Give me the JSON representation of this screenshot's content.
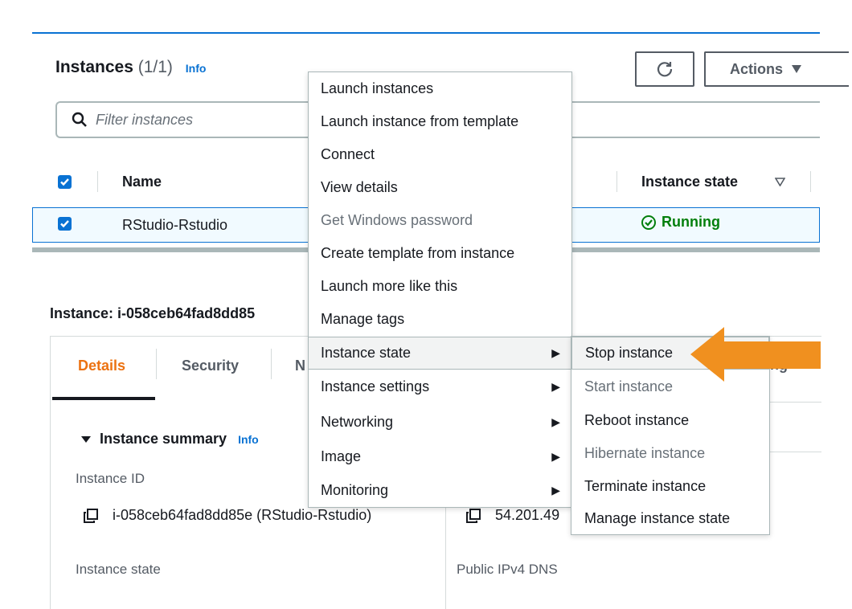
{
  "header": {
    "title": "Instances",
    "count": "(1/1)",
    "info_label": "Info",
    "actions_label": "Actions"
  },
  "search": {
    "placeholder": "Filter instances"
  },
  "table": {
    "columns": [
      "Name",
      "Instance state"
    ],
    "rows": [
      {
        "name": "RStudio-Rstudio",
        "state": "Running",
        "selected": true
      }
    ]
  },
  "detail": {
    "heading": "Instance: i-058ceb64fad8dd85",
    "tabs": [
      "Details",
      "Security",
      "N"
    ],
    "active_tab": "Details",
    "section_title": "Instance summary",
    "section_info": "Info",
    "fields": {
      "instance_id_label": "Instance ID",
      "instance_id_value": "i-058ceb64fad8dd85e (RStudio-Rstudio)",
      "public_ip_value": "54.201.49",
      "instance_state_label": "Instance state",
      "public_dns_label": "Public IPv4 DNS"
    },
    "partial_right_text": "ng"
  },
  "actions_menu": {
    "items": [
      {
        "label": "Launch instances",
        "disabled": false,
        "submenu": false
      },
      {
        "label": "Launch instance from template",
        "disabled": false,
        "submenu": false
      },
      {
        "label": "Connect",
        "disabled": false,
        "submenu": false
      },
      {
        "label": "View details",
        "disabled": false,
        "submenu": false
      },
      {
        "label": "Get Windows password",
        "disabled": true,
        "submenu": false
      },
      {
        "label": "Create template from instance",
        "disabled": false,
        "submenu": false
      },
      {
        "label": "Launch more like this",
        "disabled": false,
        "submenu": false
      },
      {
        "label": "Manage tags",
        "disabled": false,
        "submenu": false
      },
      {
        "label": "Instance state",
        "disabled": false,
        "submenu": true,
        "highlighted": true
      },
      {
        "label": "Instance settings",
        "disabled": false,
        "submenu": true
      },
      {
        "label": "Networking",
        "disabled": false,
        "submenu": true
      },
      {
        "label": "Image",
        "disabled": false,
        "submenu": true
      },
      {
        "label": "Monitoring",
        "disabled": false,
        "submenu": true
      }
    ]
  },
  "instance_state_submenu": {
    "items": [
      {
        "label": "Stop instance",
        "disabled": false,
        "highlighted": true
      },
      {
        "label": "Start instance",
        "disabled": true
      },
      {
        "label": "Reboot instance",
        "disabled": false
      },
      {
        "label": "Hibernate instance",
        "disabled": true
      },
      {
        "label": "Terminate instance",
        "disabled": false
      },
      {
        "label": "Manage instance state",
        "disabled": false
      }
    ]
  },
  "colors": {
    "primary_blue": "#0972d3",
    "running_green": "#037f0c",
    "active_tab_orange": "#ec7211",
    "callout_arrow_orange": "#f0901f"
  },
  "icons": [
    "refresh-icon",
    "caret-down-icon",
    "search-icon",
    "checkbox-checked-icon",
    "sort-caret-icon",
    "status-running-icon",
    "copy-icon",
    "triangle-expanded-icon",
    "submenu-arrow-icon",
    "callout-arrow-icon"
  ]
}
